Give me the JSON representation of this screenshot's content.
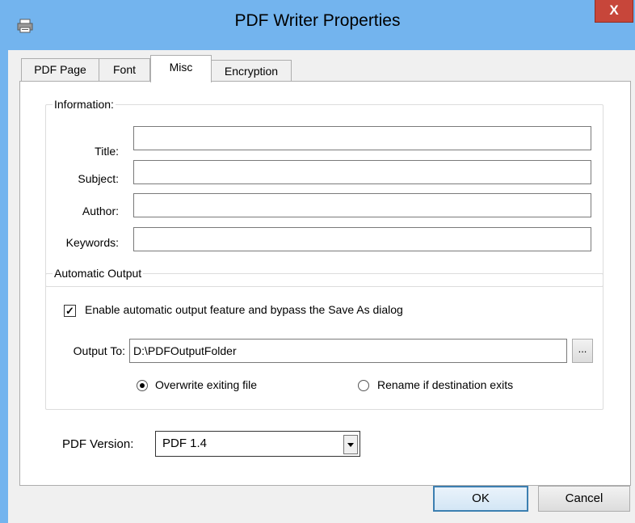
{
  "window": {
    "title": "PDF Writer Properties",
    "icon": "printer-icon",
    "close_glyph": "X"
  },
  "tabs": [
    {
      "label": "PDF Page",
      "active": false
    },
    {
      "label": "Font",
      "active": false
    },
    {
      "label": "Misc",
      "active": true
    },
    {
      "label": "Encryption",
      "active": false
    }
  ],
  "information": {
    "legend": "Information:",
    "title_label": "Title:",
    "title_value": "",
    "subject_label": "Subject:",
    "subject_value": "",
    "author_label": "Author:",
    "author_value": "",
    "keywords_label": "Keywords:",
    "keywords_value": ""
  },
  "automatic_output": {
    "legend": "Automatic Output",
    "enable_label": "Enable automatic output feature and bypass the Save As dialog",
    "enable_checked": true,
    "output_to_label": "Output To:",
    "output_to_value": "D:\\PDFOutputFolder",
    "browse_label": "...",
    "overwrite_label": "Overwrite exiting file",
    "rename_label": "Rename if destination exits",
    "selected_option": "overwrite"
  },
  "pdf_version": {
    "label": "PDF Version:",
    "value": "PDF 1.4"
  },
  "buttons": {
    "ok": "OK",
    "cancel": "Cancel"
  },
  "colors": {
    "frame": "#73b4ee",
    "close": "#c7463a",
    "default_button_border": "#3c7fb1"
  }
}
